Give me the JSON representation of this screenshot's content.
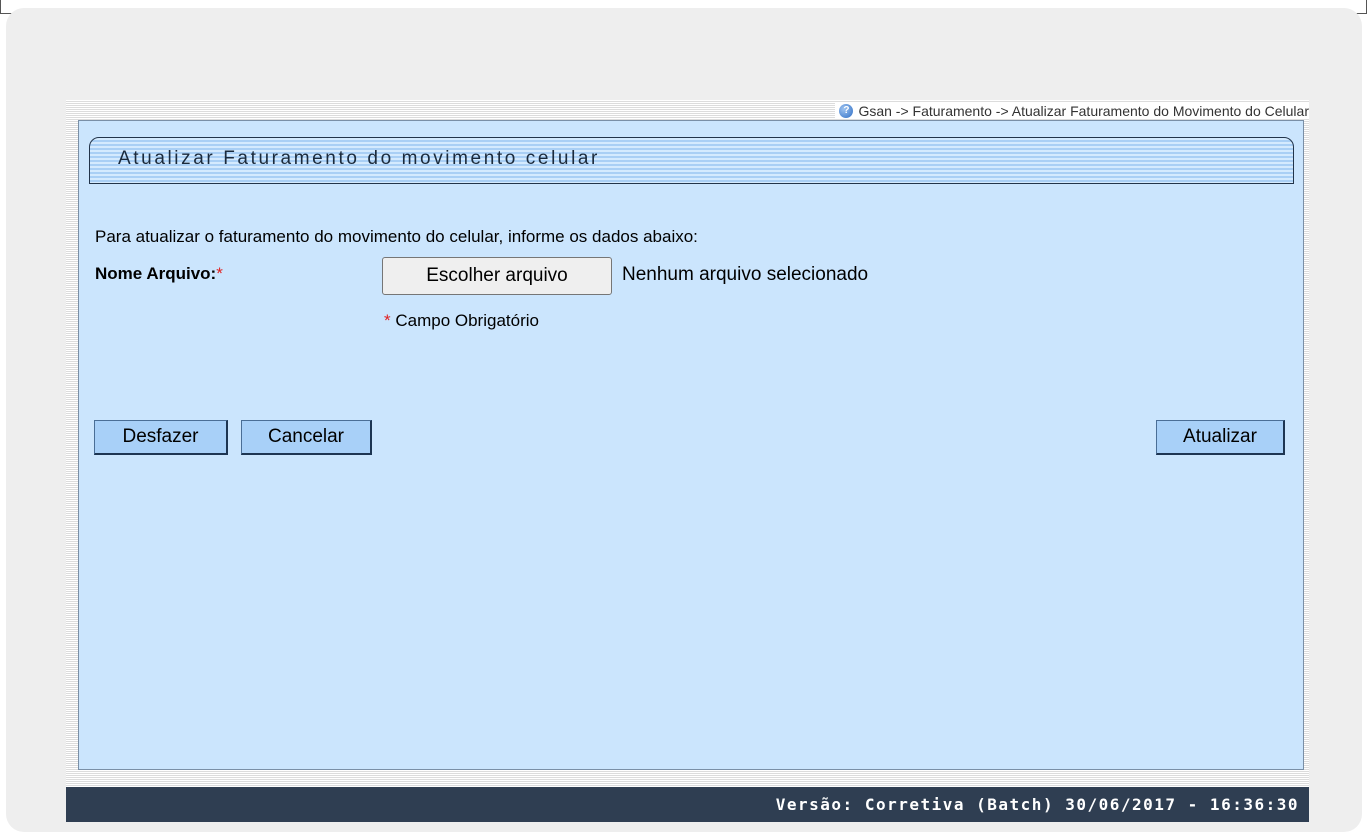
{
  "breadcrumb": {
    "icon": "help-icon",
    "text": "Gsan -> Faturamento -> Atualizar Faturamento do Movimento do Celular"
  },
  "panel": {
    "title": "Atualizar Faturamento do movimento celular",
    "intro": "Para atualizar o faturamento do movimento do celular, informe os dados abaixo:"
  },
  "form": {
    "file_label": "Nome Arquivo:",
    "required_mark": "*",
    "file_button_label": "Escolher arquivo",
    "file_status": "Nenhum arquivo selecionado",
    "required_note": "Campo Obrigatório"
  },
  "buttons": {
    "undo": "Desfazer",
    "cancel": "Cancelar",
    "update": "Atualizar"
  },
  "footer": {
    "version": "Versão: Corretiva (Batch) 30/06/2017 - 16:36:30"
  },
  "colors": {
    "panel_background": "#cbe5fd",
    "button_background": "#a8d0f8",
    "footer_background": "#2f3e52",
    "required_mark": "#e02020"
  }
}
